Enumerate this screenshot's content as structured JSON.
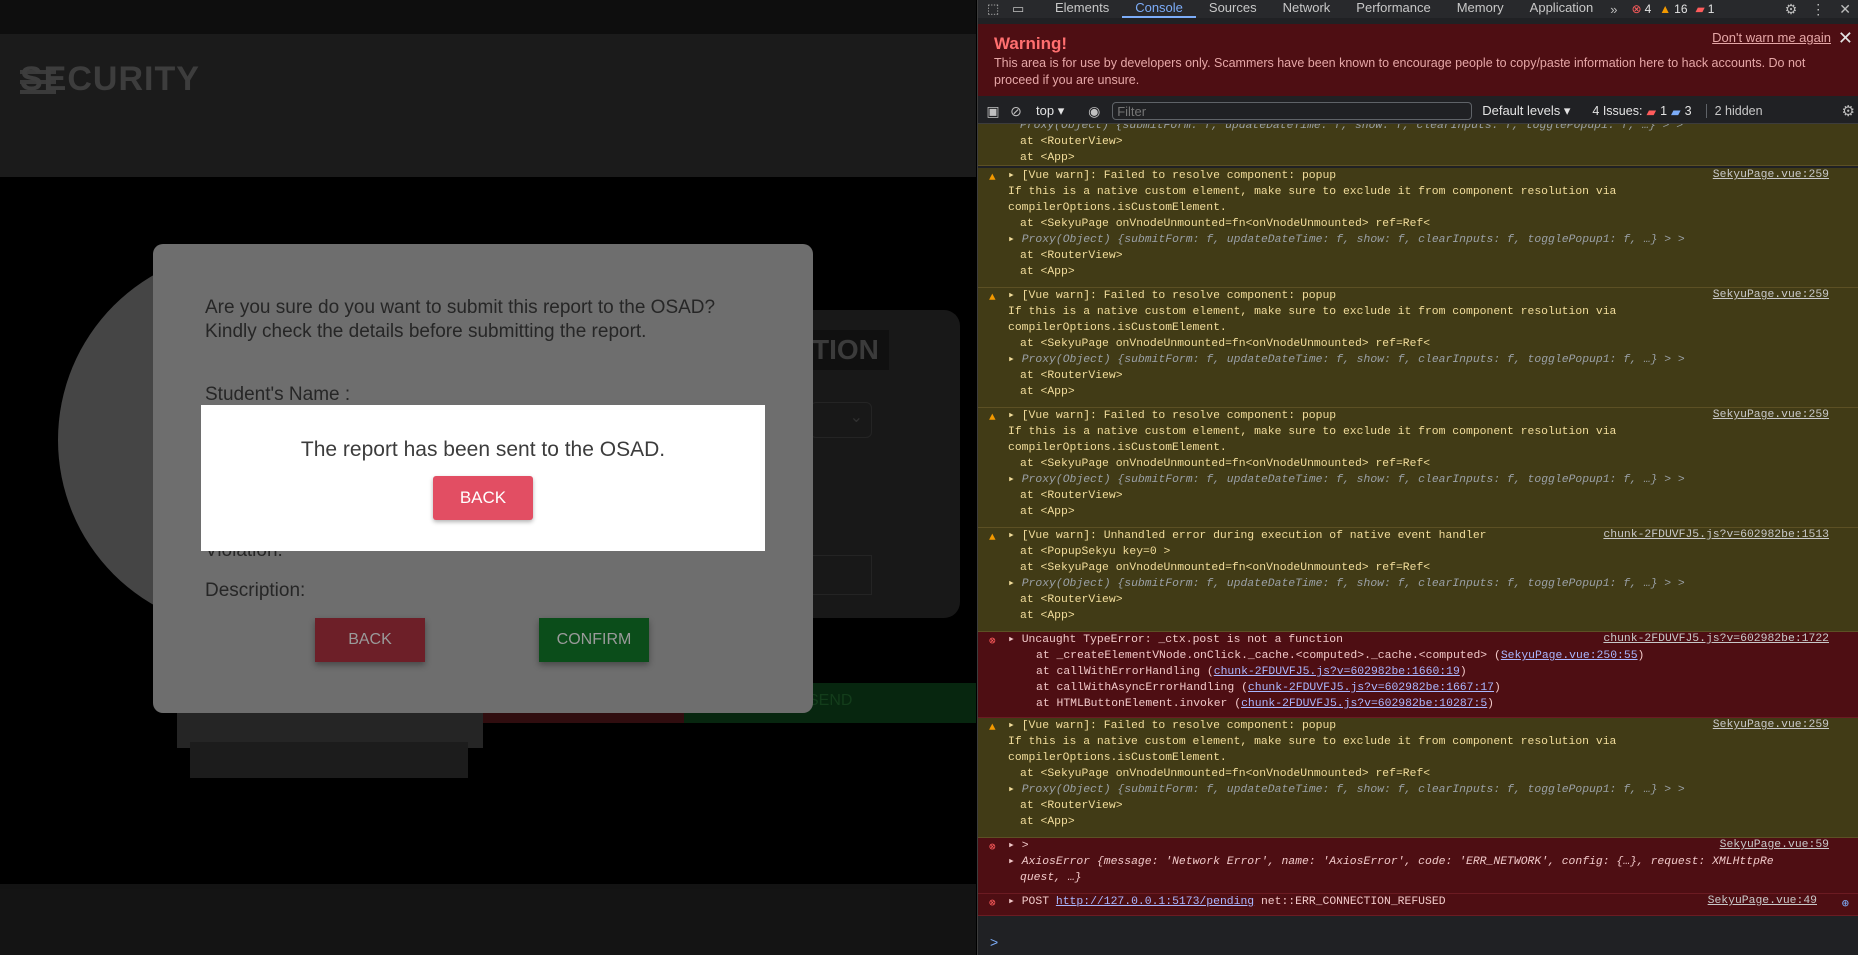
{
  "app": {
    "logo": "SECURITY",
    "confirm_modal": {
      "question": "Are you sure do you want to submit this report to the OSAD? Kindly check the details before submitting the report.",
      "student_name_label": "Student's Name :",
      "violation_label": "Violation:",
      "description_label": "Description:",
      "back_label": "BACK",
      "confirm_label": "CONFIRM"
    },
    "success_popup": {
      "message": "The report has been sent to the OSAD.",
      "back_label": "BACK"
    },
    "background": {
      "card_title": "TION",
      "send_label": "SEND"
    }
  },
  "devtools": {
    "tabs": [
      "Elements",
      "Console",
      "Sources",
      "Network",
      "Performance",
      "Memory",
      "Application"
    ],
    "active_tab": "Console",
    "counts": {
      "errors": "4",
      "warnings": "16",
      "issues": "1"
    },
    "warning_banner": {
      "title": "Warning!",
      "text": "This area is for use by developers only. Scammers have been known to encourage people to copy/paste information here to hack accounts. Do not proceed if you are unsure.",
      "dont_warn": "Don't warn me again"
    },
    "toolbar": {
      "context": "top",
      "filter_placeholder": "Filter",
      "levels": "Default levels",
      "issues_label": "4 Issues:",
      "issues_err": "1",
      "issues_info": "3",
      "hidden": "2 hidden"
    },
    "messages": {
      "top_partial": [
        "Proxy(Object) {submitForm: f, updateDateTime: f, show: f, clearInputs: f, togglePopup1: f, …} > >",
        "at <RouterView>",
        "at <App>"
      ],
      "vue_warn_popup": {
        "head": "[Vue warn]: Failed to resolve component: popup",
        "l2": "If this is a native custom element, make sure to exclude it from component resolution via",
        "l3": "compilerOptions.isCustomElement.",
        "l4": "at <SekyuPage onVnodeUnmounted=fn<onVnodeUnmounted> ref=Ref<",
        "l5": "Proxy(Object) {submitForm: f, updateDateTime: f, show: f, clearInputs: f, togglePopup1: f, …} > >",
        "l6": "at <RouterView>",
        "l7": "at <App>",
        "src": "SekyuPage.vue:259"
      },
      "vue_warn_unhandled": {
        "head": "[Vue warn]: Unhandled error during execution of native event handler",
        "l2": "at <PopupSekyu key=0 >",
        "l3": "at <SekyuPage onVnodeUnmounted=fn<onVnodeUnmounted> ref=Ref<",
        "l4": "Proxy(Object) {submitForm: f, updateDateTime: f, show: f, clearInputs: f, togglePopup1: f, …} > >",
        "l5": "at <RouterView>",
        "l6": "at <App>",
        "src": "chunk-2FDUVFJ5.js?v=602982be:1513"
      },
      "type_error": {
        "head": "Uncaught TypeError: _ctx.post is not a function",
        "l2a": "at _createElementVNode.onClick._cache.<computed>._cache.<computed> (",
        "l2link": "SekyuPage.vue:250:55",
        "l3a": "at callWithErrorHandling (",
        "l3link": "chunk-2FDUVFJ5.js?v=602982be:1660:19",
        "l4a": "at callWithAsyncErrorHandling (",
        "l4link": "chunk-2FDUVFJ5.js?v=602982be:1667:17",
        "l5a": "at HTMLButtonElement.invoker (",
        "l5link": "chunk-2FDUVFJ5.js?v=602982be:10287:5",
        "close": ")",
        "src": "chunk-2FDUVFJ5.js?v=602982be:1722"
      },
      "axios_error": {
        "head": ">",
        "l2": "AxiosError {message: 'Network Error', name: 'AxiosError', code: 'ERR_NETWORK', config: {…}, request: XMLHttpRe",
        "l3": "quest, …}",
        "src": "SekyuPage.vue:59"
      },
      "post_error": {
        "method": "POST",
        "url": "http://127.0.0.1:5173/pending",
        "err": "net::ERR_CONNECTION_REFUSED",
        "src": "SekyuPage.vue:49"
      }
    },
    "prompt_symbol": ">"
  }
}
